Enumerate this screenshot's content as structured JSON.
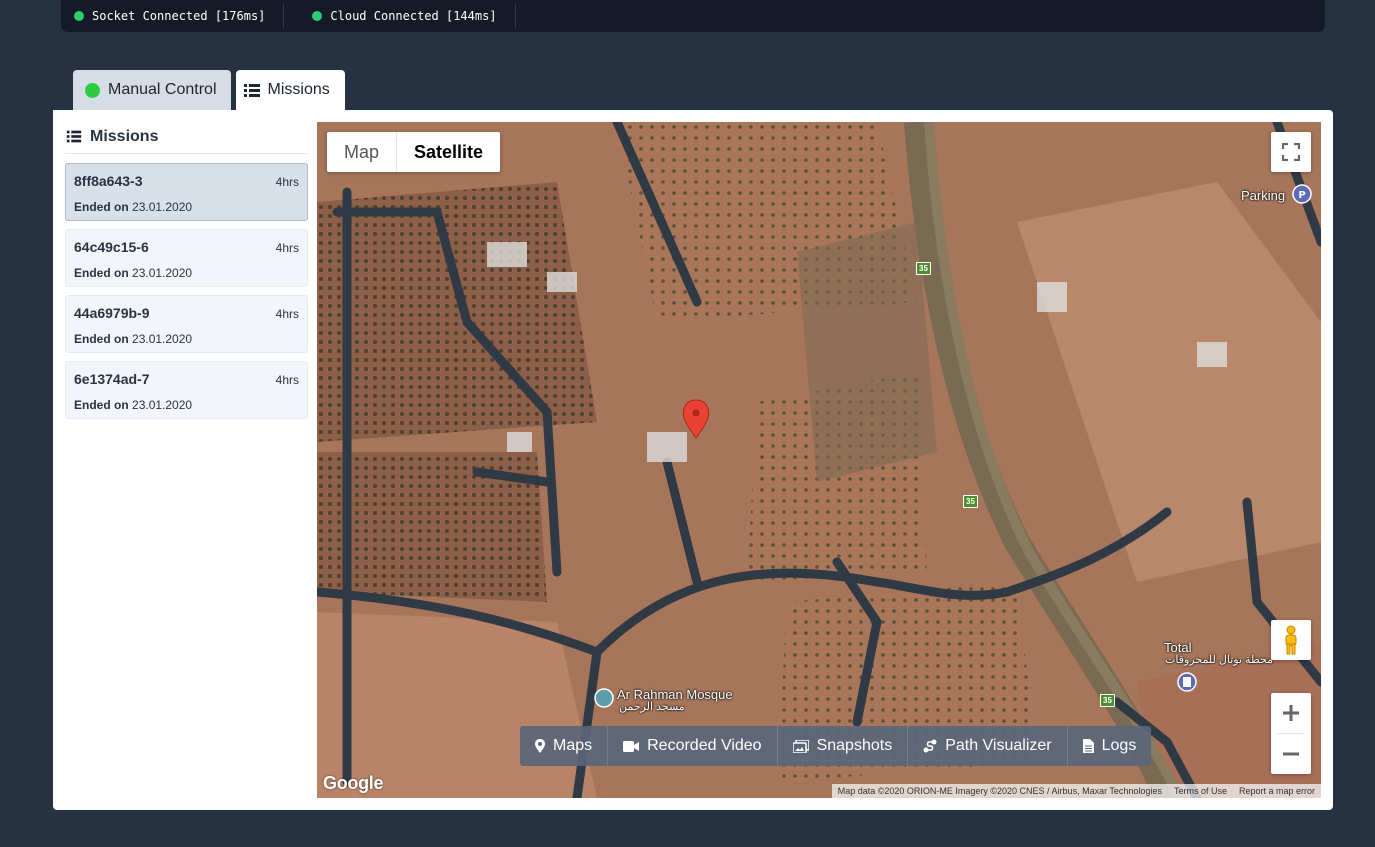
{
  "status_bar": {
    "items": [
      {
        "label": "Socket Connected [176ms]",
        "color": "#2ecc71"
      },
      {
        "label": "Cloud Connected [144ms]",
        "color": "#2ecc71"
      }
    ]
  },
  "tabs": [
    {
      "label": "Manual Control",
      "icon": "status-dot",
      "active": false
    },
    {
      "label": "Missions",
      "icon": "list-icon",
      "active": true
    }
  ],
  "sidebar": {
    "title": "Missions",
    "items": [
      {
        "id": "8ff8a643-3",
        "duration": "4hrs",
        "ended_label": "Ended on",
        "date": "23.01.2020",
        "selected": true
      },
      {
        "id": "64c49c15-6",
        "duration": "4hrs",
        "ended_label": "Ended on",
        "date": "23.01.2020",
        "selected": false
      },
      {
        "id": "44a6979b-9",
        "duration": "4hrs",
        "ended_label": "Ended on",
        "date": "23.01.2020",
        "selected": false
      },
      {
        "id": "6e1374ad-7",
        "duration": "4hrs",
        "ended_label": "Ended on",
        "date": "23.01.2020",
        "selected": false
      }
    ]
  },
  "map": {
    "type_buttons": {
      "map": "Map",
      "satellite": "Satellite"
    },
    "labels": {
      "parking": "Parking",
      "mosque": "Ar Rahman Mosque",
      "mosque_ar": "مسجد الرحمن",
      "total": "Total",
      "total_ar": "محطة توتال للمحروقات",
      "road": "35"
    },
    "logo": "Google",
    "attribution": {
      "data": "Map data ©2020 ORION-ME Imagery ©2020 CNES / Airbus, Maxar Technologies",
      "terms": "Terms of Use",
      "report": "Report a map error"
    },
    "toolbar": [
      {
        "label": "Maps",
        "icon": "map-marker-icon"
      },
      {
        "label": "Recorded Video",
        "icon": "video-camera-icon"
      },
      {
        "label": "Snapshots",
        "icon": "images-icon"
      },
      {
        "label": "Path Visualizer",
        "icon": "route-icon"
      },
      {
        "label": "Logs",
        "icon": "file-icon"
      }
    ]
  }
}
